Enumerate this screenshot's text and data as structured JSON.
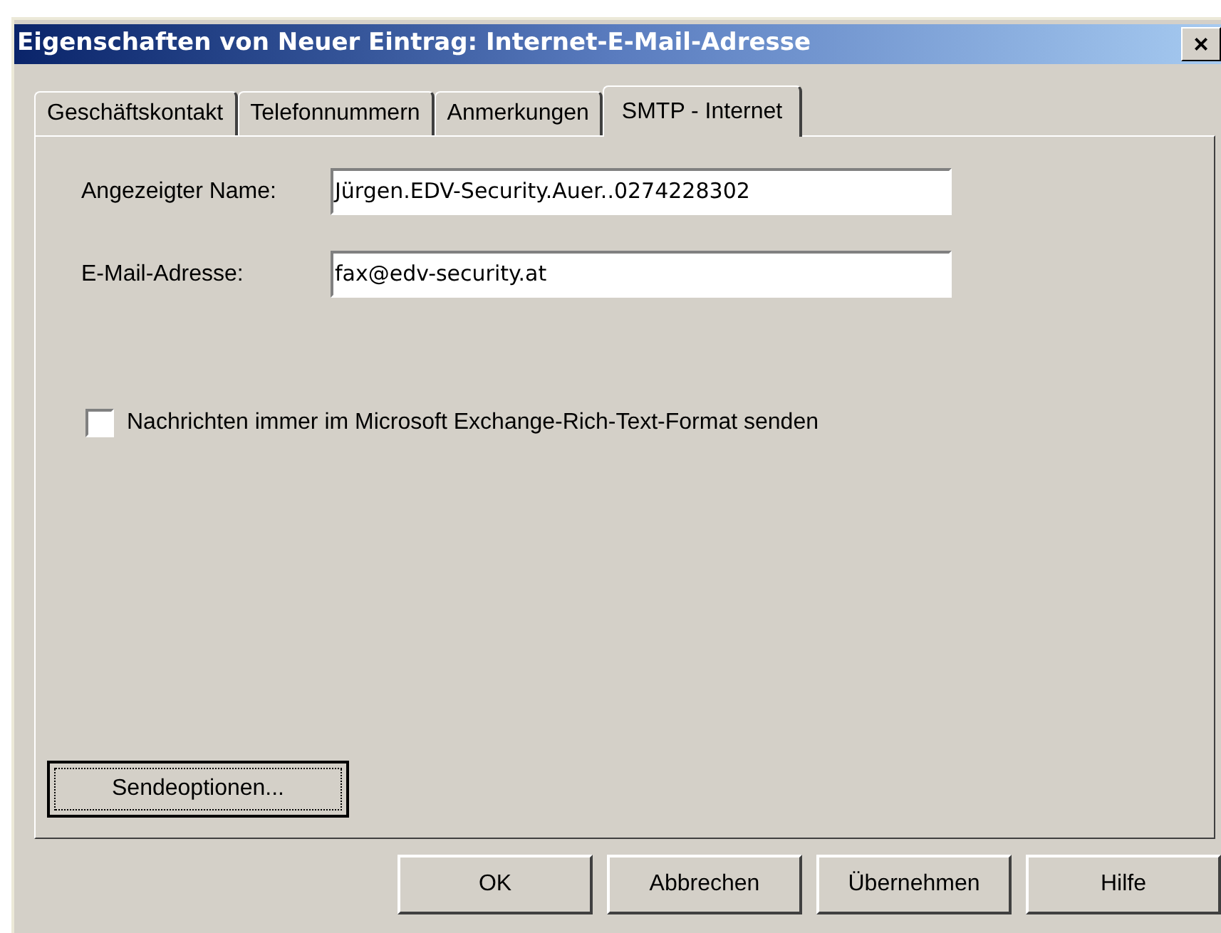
{
  "window": {
    "title": "Eigenschaften von Neuer Eintrag: Internet-E-Mail-Adresse",
    "close": "×"
  },
  "tabs": [
    {
      "label": "Geschäftskontakt",
      "selected": false
    },
    {
      "label": "Telefonnummern",
      "selected": false
    },
    {
      "label": "Anmerkungen",
      "selected": false
    },
    {
      "label": "SMTP - Internet",
      "selected": true
    }
  ],
  "fields": [
    {
      "label": "Angezeigter Name:",
      "value": "Jürgen.EDV-Security.Auer..0274228302"
    },
    {
      "label": "E-Mail-Adresse:",
      "value": "fax@edv-security.at"
    }
  ],
  "checkbox": {
    "label": "Nachrichten immer im Microsoft Exchange-Rich-Text-Format senden",
    "checked": false
  },
  "send_options_button": "Sendeoptionen...",
  "buttons": [
    "OK",
    "Abbrechen",
    "Übernehmen",
    "Hilfe"
  ]
}
